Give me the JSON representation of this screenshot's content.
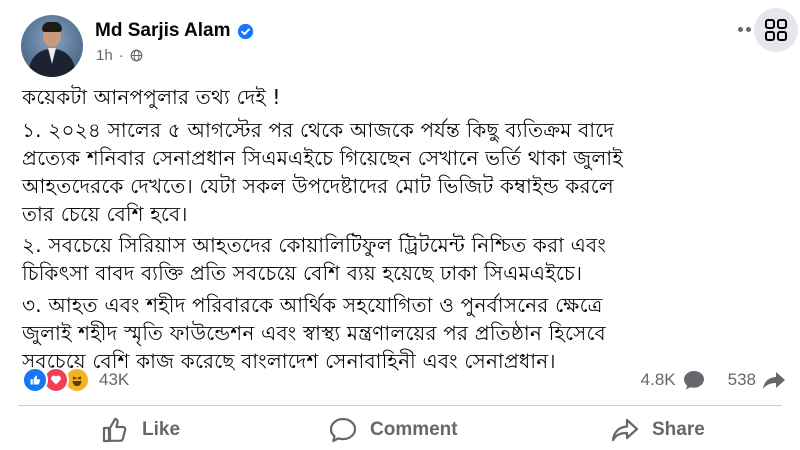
{
  "author": {
    "name": "Md Sarjis Alam",
    "verified": true
  },
  "meta": {
    "time": "1h",
    "separator": "·",
    "audience_icon": "globe-icon"
  },
  "post_lines": [
    "কয়েকটা আনপপুলার তথ্য দেই !",
    "১. ২০২৪ সালের ৫ আগস্টের পর থেকে আজকে পর্যন্ত কিছু ব্যতিক্রম বাদে",
    "প্রত্যেক শনিবার সেনাপ্রধান সিএমএইচে গিয়েছেন সেখানে ভর্তি থাকা জুলাই",
    "আহতদেরকে দেখতে। যেটা সকল উপদেষ্টাদের মোট ভিজিট কম্বাইন্ড করলে",
    "তার চেয়ে বেশি হবে।",
    "২. সবচেয়ে সিরিয়াস আহতদের কোয়ালিটিফুল ট্রিটমেন্ট নিশ্চিত করা এবং",
    "চিকিৎসা বাবদ ব্যক্তি প্রতি সবচেয়ে বেশি ব্যয় হয়েছে ঢাকা সিএমএইচে।",
    "৩. আহত এবং শহীদ পরিবারকে আর্থিক সহযোগিতা ও পুনর্বাসনের ক্ষেত্রে",
    "জুলাই শহীদ স্মৃতি ফাউন্ডেশন এবং স্বাস্থ্য মন্ত্রণালয়ের পর প্রতিষ্ঠান হিসেবে",
    "সবচেয়ে বেশি কাজ করেছে বাংলাদেশ সেনাবাহিনী এবং সেনাপ্রধান।"
  ],
  "reactions": {
    "types": [
      "like",
      "love",
      "haha"
    ],
    "count": "43K"
  },
  "stats": {
    "comments": "4.8K",
    "shares": "538"
  },
  "actions": {
    "like": "Like",
    "comment": "Comment",
    "share": "Share"
  },
  "colors": {
    "accent": "#1877f2",
    "love": "#f33e58",
    "haha": "#f7b125",
    "secondary_text": "#65676b",
    "verified": "#1877f2"
  }
}
